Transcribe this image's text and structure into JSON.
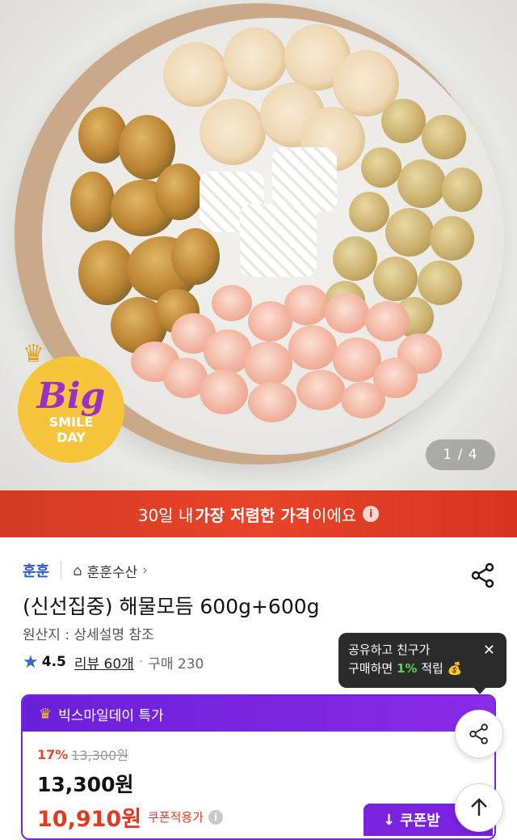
{
  "hero": {
    "badge": {
      "big": "Big",
      "line1": "SMILE",
      "line2": "DAY"
    },
    "image_counter": "1 / 4"
  },
  "price_banner": {
    "before": "30일 내 ",
    "strong": "가장 저렴한 가격",
    "after": "이에요"
  },
  "product": {
    "brand": "훈훈",
    "store": "훈훈수산",
    "title": "(신선집중) 해물모듬 600g+600g",
    "origin": "원산지 : 상세설명 참조",
    "rating": "4.5",
    "review_link": "리뷰 60개",
    "purchase_count": "구매 230"
  },
  "tooltip": {
    "line1": "공유하고 친구가",
    "line2_before": "구매하면 ",
    "line2_pct": "1%",
    "line2_after": " 적립"
  },
  "promo": {
    "header": "빅스마일데이 특가",
    "discount_pct": "17%",
    "original_price": "13,300원",
    "sale_price": "13,300원",
    "final_price": "10,910원",
    "coupon_label": "쿠폰적용가",
    "coupon_button": "쿠폰받"
  },
  "colors": {
    "banner_red": "#e8442a",
    "promo_purple": "#7a22e0",
    "brand_blue": "#2b57c8",
    "price_red": "#e5391f"
  }
}
